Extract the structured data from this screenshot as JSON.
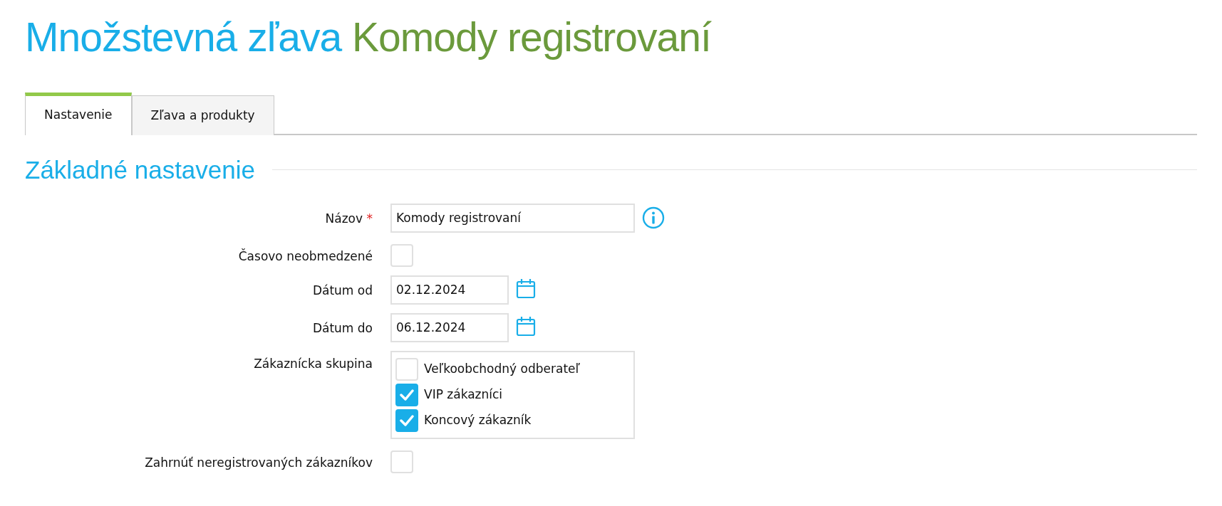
{
  "heading": {
    "prefix": "Množstevná zľava",
    "name": "Komody registrovaní"
  },
  "tabs": [
    {
      "label": "Nastavenie",
      "selected": true
    },
    {
      "label": "Zľava a produkty",
      "selected": false
    }
  ],
  "section": {
    "title": "Základné nastavenie"
  },
  "fields": [
    {
      "kind": "text",
      "label": "Názov",
      "required_mark": "*",
      "value": "Komody registrovaní",
      "info": true
    },
    {
      "kind": "checkbox",
      "label": "Časovo neobmedzené",
      "checked": false
    },
    {
      "kind": "date",
      "label": "Dátum od",
      "value": "02.12.2024"
    },
    {
      "kind": "date",
      "label": "Dátum do",
      "value": "06.12.2024"
    },
    {
      "kind": "group",
      "label": "Zákaznícka skupina",
      "options": [
        {
          "label": "Veľkoobchodný odberateľ",
          "checked": false
        },
        {
          "label": "VIP zákazníci",
          "checked": true
        },
        {
          "label": "Koncový zákazník",
          "checked": true
        }
      ]
    },
    {
      "kind": "checkbox",
      "label": "Zahrnúť neregistrovaných zákazníkov",
      "checked": false
    }
  ]
}
